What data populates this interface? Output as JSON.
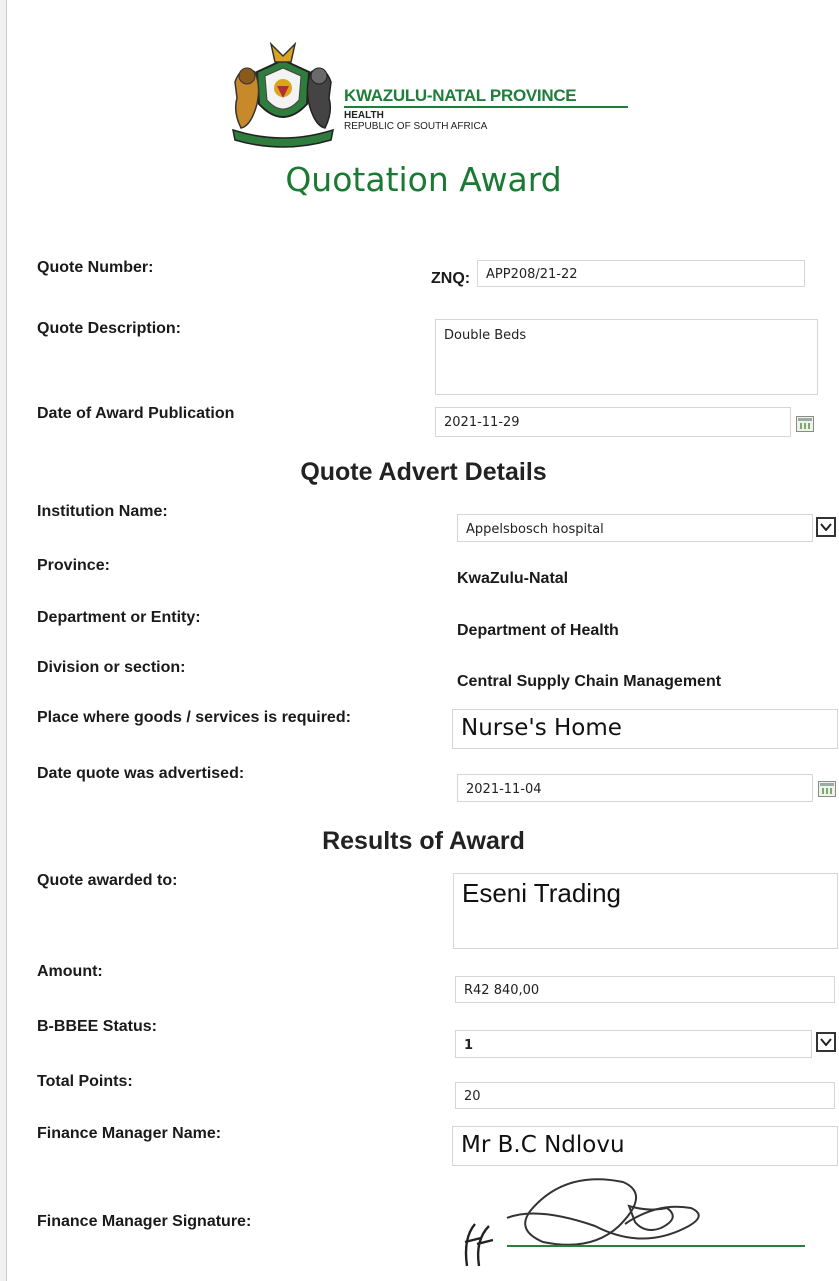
{
  "header": {
    "province": "KWAZULU-NATAL PROVINCE",
    "dept": "HEALTH",
    "country": "REPUBLIC OF SOUTH AFRICA",
    "title": "Quotation Award"
  },
  "quote": {
    "number_label": "Quote Number:",
    "number_prefix": "ZNQ:",
    "number_value": "APP208/21-22",
    "description_label": "Quote Description:",
    "description_value": "Double Beds",
    "award_date_label": "Date of Award Publication",
    "award_date_value": "2021-11-29"
  },
  "advert": {
    "section_title": "Quote Advert Details",
    "institution_label": "Institution Name:",
    "institution_value": "Appelsbosch hospital",
    "province_label": "Province:",
    "province_value": "KwaZulu-Natal",
    "department_label": "Department or Entity:",
    "department_value": "Department of Health",
    "division_label": "Division or section:",
    "division_value": "Central Supply Chain Management",
    "place_label": "Place where goods /  services is required:",
    "place_value": "Nurse's Home",
    "advertised_label": "Date quote was advertised:",
    "advertised_value": "2021-11-04"
  },
  "results": {
    "section_title": "Results of Award",
    "awarded_label": "Quote awarded to:",
    "awarded_value": "Eseni Trading",
    "amount_label": "Amount:",
    "amount_value": "R42 840,00",
    "bbbee_label": "B-BBEE Status:",
    "bbbee_value": "1",
    "points_label": "Total Points:",
    "points_value": "20",
    "manager_label": "Finance Manager Name:",
    "manager_value": "Mr B.C Ndlovu",
    "signature_label": "Finance Manager Signature:"
  },
  "colors": {
    "brand_green": "#1e7f3a",
    "title_green": "#1a7a33"
  }
}
